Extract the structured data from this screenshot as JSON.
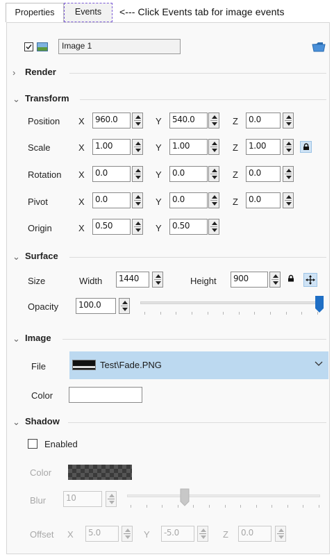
{
  "tabs": {
    "properties": "Properties",
    "events": "Events"
  },
  "annotation": "<--- Click Events tab for image events",
  "object": {
    "enabled": true,
    "name": "Image 1"
  },
  "sections": {
    "render": "Render",
    "transform": "Transform",
    "surface": "Surface",
    "image": "Image",
    "shadow": "Shadow"
  },
  "axes": {
    "x": "X",
    "y": "Y",
    "z": "Z"
  },
  "transform": {
    "position": {
      "label": "Position",
      "x": "960.0",
      "y": "540.0",
      "z": "0.0"
    },
    "scale": {
      "label": "Scale",
      "x": "1.00",
      "y": "1.00",
      "z": "1.00"
    },
    "rotation": {
      "label": "Rotation",
      "x": "0.0",
      "y": "0.0",
      "z": "0.0"
    },
    "pivot": {
      "label": "Pivot",
      "x": "0.0",
      "y": "0.0",
      "z": "0.0"
    },
    "origin": {
      "label": "Origin",
      "x": "0.50",
      "y": "0.50"
    }
  },
  "surface": {
    "size_label": "Size",
    "width_label": "Width",
    "width": "1440",
    "height_label": "Height",
    "height": "900",
    "opacity_label": "Opacity",
    "opacity": "100.0",
    "opacity_slider_fraction": 1.0
  },
  "image": {
    "file_label": "File",
    "file": "Test\\Fade.PNG",
    "color_label": "Color",
    "color": "#ffffff"
  },
  "shadow": {
    "enabled_label": "Enabled",
    "enabled": false,
    "color_label": "Color",
    "blur_label": "Blur",
    "blur": "10",
    "blur_slider_fraction": 0.3,
    "offset_label": "Offset",
    "offset": {
      "x": "5.0",
      "y": "-5.0",
      "z": "0.0"
    }
  },
  "colors": {
    "accent": "#1f6fc5",
    "selection": "#bcd9f0"
  }
}
